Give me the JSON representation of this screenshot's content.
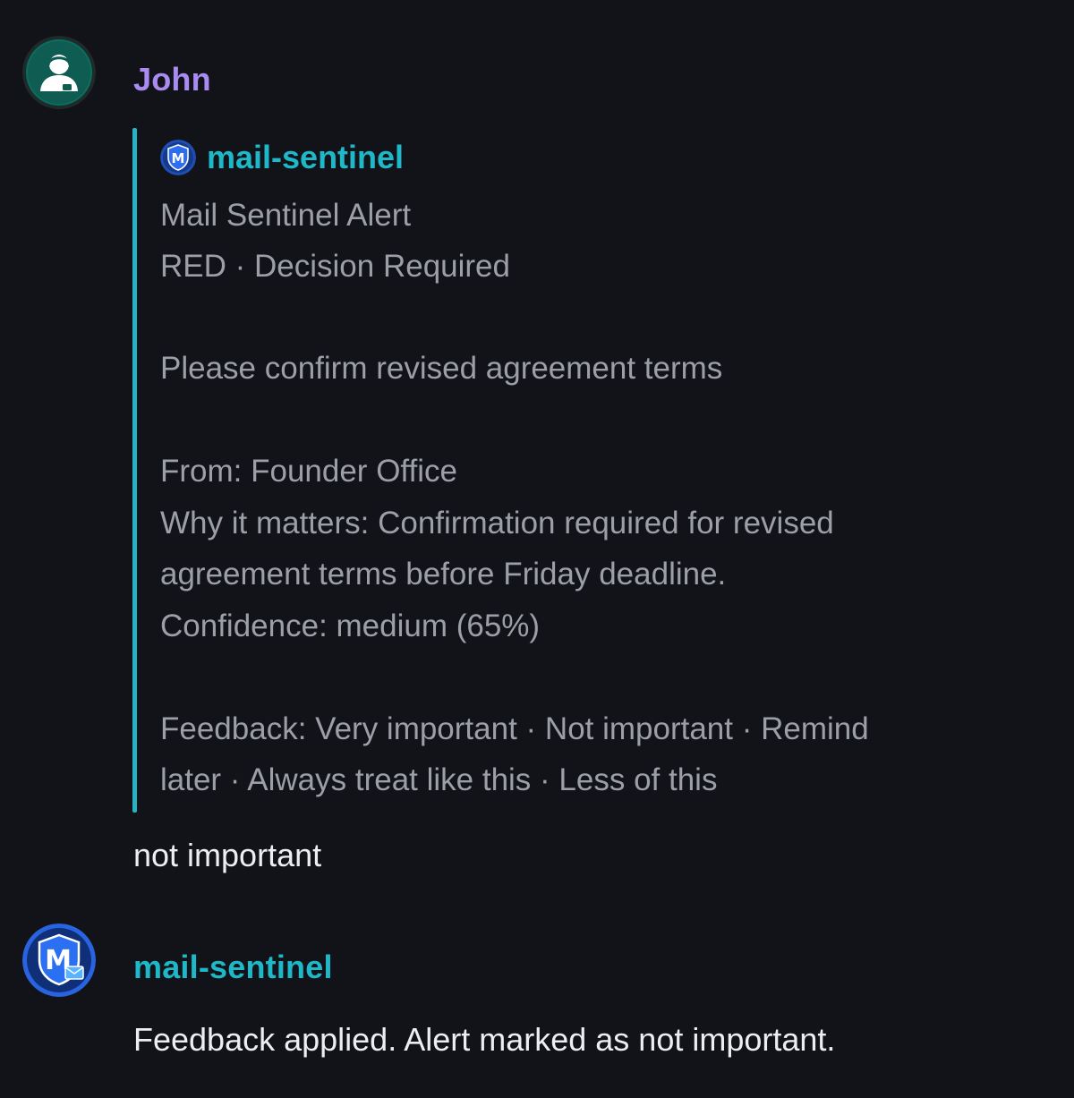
{
  "messages": [
    {
      "author": "John",
      "avatar_icon": "person-headset-icon",
      "quote": {
        "author": "mail-sentinel",
        "icon": "shield-m-icon",
        "lines": [
          "Mail Sentinel Alert",
          "RED · Decision Required",
          "Please confirm revised agreement terms",
          "From: Founder Office",
          "Why it matters: Confirmation required for revised",
          "agreement terms before Friday deadline.",
          "Confidence: medium (65%)",
          "Feedback: Very important · Not important · Remind",
          "later · Always treat like this · Less of this"
        ]
      },
      "text": "not important"
    },
    {
      "author": "mail-sentinel",
      "avatar_icon": "shield-m-mail-icon",
      "text": "Feedback applied. Alert marked as not important."
    }
  ],
  "colors": {
    "background": "#111318",
    "user_name": "#a98bf2",
    "bot_name": "#1fb8c8",
    "quote_bar": "#26b4c4",
    "quote_text": "#9c9fa6",
    "message_text": "#eceef1"
  }
}
